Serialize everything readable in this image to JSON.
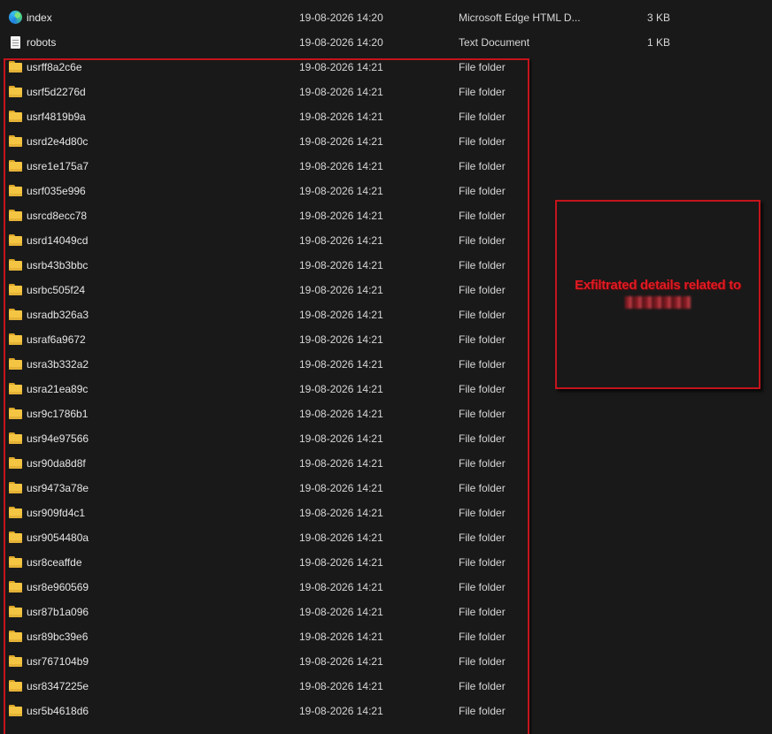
{
  "files": [
    {
      "name": "index",
      "date": "19-08-2026 14:20",
      "type": "Microsoft Edge HTML D...",
      "size": "3 KB",
      "icon": "edge-html-icon"
    },
    {
      "name": "robots",
      "date": "19-08-2026 14:20",
      "type": "Text Document",
      "size": "1 KB",
      "icon": "text-document-icon"
    },
    {
      "name": "usrff8a2c6e",
      "date": "19-08-2026 14:21",
      "type": "File folder",
      "size": "",
      "icon": "folder-icon"
    },
    {
      "name": "usrf5d2276d",
      "date": "19-08-2026 14:21",
      "type": "File folder",
      "size": "",
      "icon": "folder-icon"
    },
    {
      "name": "usrf4819b9a",
      "date": "19-08-2026 14:21",
      "type": "File folder",
      "size": "",
      "icon": "folder-icon"
    },
    {
      "name": "usrd2e4d80c",
      "date": "19-08-2026 14:21",
      "type": "File folder",
      "size": "",
      "icon": "folder-icon"
    },
    {
      "name": "usre1e175a7",
      "date": "19-08-2026 14:21",
      "type": "File folder",
      "size": "",
      "icon": "folder-icon"
    },
    {
      "name": "usrf035e996",
      "date": "19-08-2026 14:21",
      "type": "File folder",
      "size": "",
      "icon": "folder-icon"
    },
    {
      "name": "usrcd8ecc78",
      "date": "19-08-2026 14:21",
      "type": "File folder",
      "size": "",
      "icon": "folder-icon"
    },
    {
      "name": "usrd14049cd",
      "date": "19-08-2026 14:21",
      "type": "File folder",
      "size": "",
      "icon": "folder-icon"
    },
    {
      "name": "usrb43b3bbc",
      "date": "19-08-2026 14:21",
      "type": "File folder",
      "size": "",
      "icon": "folder-icon"
    },
    {
      "name": "usrbc505f24",
      "date": "19-08-2026 14:21",
      "type": "File folder",
      "size": "",
      "icon": "folder-icon"
    },
    {
      "name": "usradb326a3",
      "date": "19-08-2026 14:21",
      "type": "File folder",
      "size": "",
      "icon": "folder-icon"
    },
    {
      "name": "usraf6a9672",
      "date": "19-08-2026 14:21",
      "type": "File folder",
      "size": "",
      "icon": "folder-icon"
    },
    {
      "name": "usra3b332a2",
      "date": "19-08-2026 14:21",
      "type": "File folder",
      "size": "",
      "icon": "folder-icon"
    },
    {
      "name": "usra21ea89c",
      "date": "19-08-2026 14:21",
      "type": "File folder",
      "size": "",
      "icon": "folder-icon"
    },
    {
      "name": "usr9c1786b1",
      "date": "19-08-2026 14:21",
      "type": "File folder",
      "size": "",
      "icon": "folder-icon"
    },
    {
      "name": "usr94e97566",
      "date": "19-08-2026 14:21",
      "type": "File folder",
      "size": "",
      "icon": "folder-icon"
    },
    {
      "name": "usr90da8d8f",
      "date": "19-08-2026 14:21",
      "type": "File folder",
      "size": "",
      "icon": "folder-icon"
    },
    {
      "name": "usr9473a78e",
      "date": "19-08-2026 14:21",
      "type": "File folder",
      "size": "",
      "icon": "folder-icon"
    },
    {
      "name": "usr909fd4c1",
      "date": "19-08-2026 14:21",
      "type": "File folder",
      "size": "",
      "icon": "folder-icon"
    },
    {
      "name": "usr9054480a",
      "date": "19-08-2026 14:21",
      "type": "File folder",
      "size": "",
      "icon": "folder-icon"
    },
    {
      "name": "usr8ceaffde",
      "date": "19-08-2026 14:21",
      "type": "File folder",
      "size": "",
      "icon": "folder-icon"
    },
    {
      "name": "usr8e960569",
      "date": "19-08-2026 14:21",
      "type": "File folder",
      "size": "",
      "icon": "folder-icon"
    },
    {
      "name": "usr87b1a096",
      "date": "19-08-2026 14:21",
      "type": "File folder",
      "size": "",
      "icon": "folder-icon"
    },
    {
      "name": "usr89bc39e6",
      "date": "19-08-2026 14:21",
      "type": "File folder",
      "size": "",
      "icon": "folder-icon"
    },
    {
      "name": "usr767104b9",
      "date": "19-08-2026 14:21",
      "type": "File folder",
      "size": "",
      "icon": "folder-icon"
    },
    {
      "name": "usr8347225e",
      "date": "19-08-2026 14:21",
      "type": "File folder",
      "size": "",
      "icon": "folder-icon"
    },
    {
      "name": "usr5b4618d6",
      "date": "19-08-2026 14:21",
      "type": "File folder",
      "size": "",
      "icon": "folder-icon"
    }
  ],
  "annotation": {
    "callout_text": "Exfiltrated details related to",
    "redacted_target": "[redacted]",
    "accent_color": "#c4141c"
  }
}
